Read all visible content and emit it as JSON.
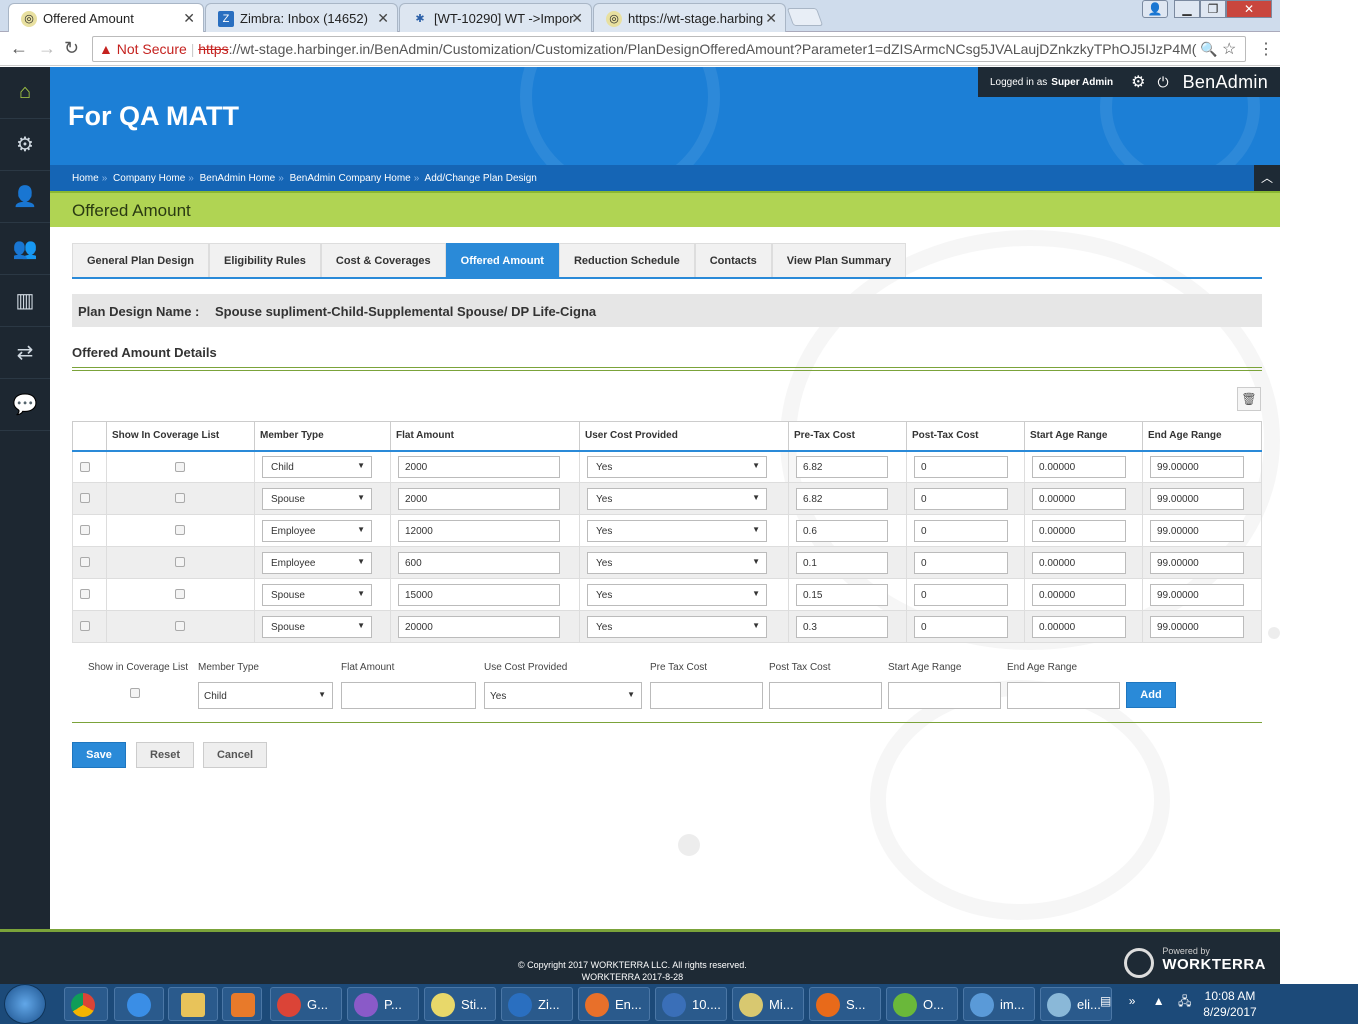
{
  "browser": {
    "tabs": [
      {
        "title": "Offered Amount",
        "active": true
      },
      {
        "title": "Zimbra: Inbox (14652)",
        "active": false
      },
      {
        "title": "[WT-10290] WT ->Impor",
        "active": false
      },
      {
        "title": "https://wt-stage.harbing",
        "active": false
      }
    ],
    "security_label": "Not Secure",
    "url_scheme": "https",
    "url_rest": "://wt-stage.harbinger.in/BenAdmin/Customization/Customization/PlanDesignOfferedAmount?Parameter1=dZISArmcNCsg5JVALaujDZnkzkyTPhOJ5IJzP4M("
  },
  "header": {
    "company_title": "For QA MATT",
    "logged_in_prefix": "Logged in as",
    "logged_in_user": "Super Admin",
    "brand": "BenAdmin"
  },
  "breadcrumb": [
    "Home",
    "Company Home",
    "BenAdmin Home",
    "BenAdmin Company Home",
    "Add/Change Plan Design"
  ],
  "page_title": "Offered Amount",
  "plan_tabs": [
    {
      "label": "General Plan Design",
      "active": false
    },
    {
      "label": "Eligibility Rules",
      "active": false
    },
    {
      "label": "Cost & Coverages",
      "active": false
    },
    {
      "label": "Offered Amount",
      "active": true
    },
    {
      "label": "Reduction Schedule",
      "active": false
    },
    {
      "label": "Contacts",
      "active": false
    },
    {
      "label": "View Plan Summary",
      "active": false
    }
  ],
  "plan_design": {
    "label": "Plan Design Name :",
    "value": "Spouse supliment-Child-Supplemental Spouse/ DP Life-Cigna"
  },
  "section_title": "Offered Amount Details",
  "table": {
    "columns": [
      "Show In Coverage List",
      "Member Type",
      "Flat Amount",
      "User Cost Provided",
      "Pre-Tax Cost",
      "Post-Tax Cost",
      "Start Age Range",
      "End Age Range"
    ],
    "rows": [
      {
        "member": "Child",
        "flat": "2000",
        "user_cost": "Yes",
        "pre": "6.82",
        "post": "0",
        "start": "0.00000",
        "end": "99.00000"
      },
      {
        "member": "Spouse",
        "flat": "2000",
        "user_cost": "Yes",
        "pre": "6.82",
        "post": "0",
        "start": "0.00000",
        "end": "99.00000"
      },
      {
        "member": "Employee",
        "flat": "12000",
        "user_cost": "Yes",
        "pre": "0.6",
        "post": "0",
        "start": "0.00000",
        "end": "99.00000"
      },
      {
        "member": "Employee",
        "flat": "600",
        "user_cost": "Yes",
        "pre": "0.1",
        "post": "0",
        "start": "0.00000",
        "end": "99.00000"
      },
      {
        "member": "Spouse",
        "flat": "15000",
        "user_cost": "Yes",
        "pre": "0.15",
        "post": "0",
        "start": "0.00000",
        "end": "99.00000"
      },
      {
        "member": "Spouse",
        "flat": "20000",
        "user_cost": "Yes",
        "pre": "0.3",
        "post": "0",
        "start": "0.00000",
        "end": "99.00000"
      }
    ]
  },
  "add_form": {
    "labels": {
      "show": "Show in Coverage List",
      "member": "Member Type",
      "flat": "Flat Amount",
      "usecost": "Use Cost Provided",
      "pre": "Pre Tax Cost",
      "post": "Post Tax Cost",
      "start": "Start Age Range",
      "end": "End Age Range"
    },
    "member_value": "Child",
    "usecost_value": "Yes",
    "add_label": "Add"
  },
  "actions": {
    "save": "Save",
    "reset": "Reset",
    "cancel": "Cancel"
  },
  "footer": {
    "copyright": "© Copyright 2017 WORKTERRA LLC. All rights reserved.",
    "build": "WORKTERRA 2017-8-28",
    "powered_by": "Powered by",
    "powered_brand": "WORKTERRA"
  },
  "taskbar": {
    "items": [
      "G...",
      "P...",
      "Sti...",
      "Zi...",
      "En...",
      "10....",
      "Mi...",
      "S...",
      "O...",
      "im...",
      "eli..."
    ],
    "time": "10:08 AM",
    "date": "8/29/2017"
  },
  "colors": {
    "accent_blue": "#2a8ad8",
    "header_blue": "#1c7fd6",
    "green": "#b0d453",
    "sidebar": "#1d2731"
  }
}
